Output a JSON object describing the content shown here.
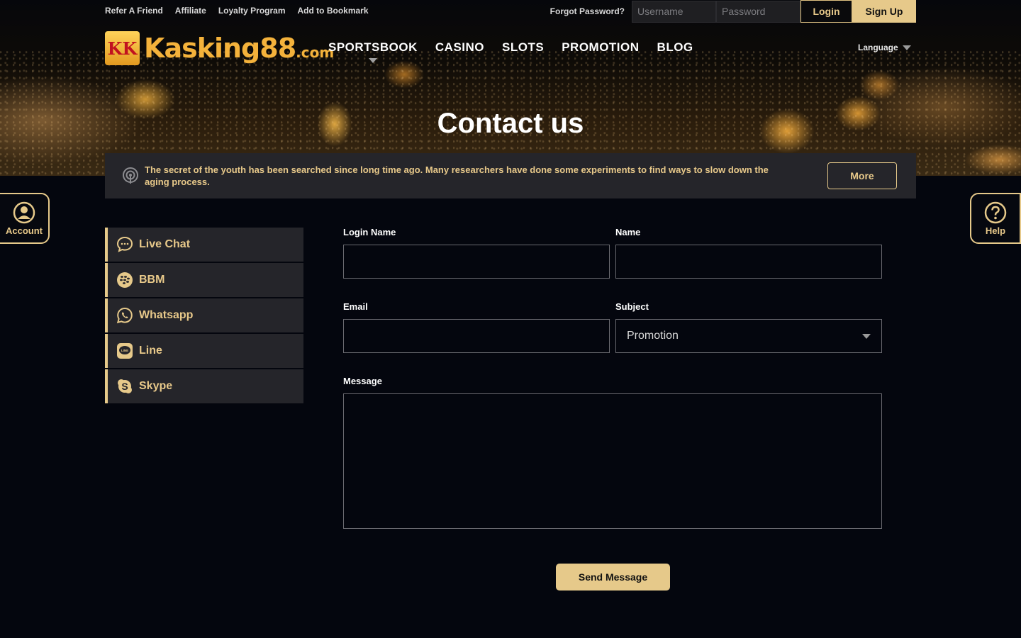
{
  "top_links": [
    "Refer A Friend",
    "Affiliate",
    "Loyalty Program",
    "Add to Bookmark"
  ],
  "auth": {
    "forgot_label": "Forgot Password?",
    "username_placeholder": "Username",
    "password_placeholder": "Password",
    "login_label": "Login",
    "signup_label": "Sign Up"
  },
  "logo": {
    "text": "Kasking88",
    "suffix": ".com",
    "mark": "KK"
  },
  "nav": [
    "SPORTSBOOK",
    "CASINO",
    "SLOTS",
    "PROMOTION",
    "BLOG"
  ],
  "language_label": "Language",
  "page_title": "Contact us",
  "announcement": {
    "text": "The secret of the youth has been searched since long time ago. Many researchers have done some experiments to find ways to slow down the aging process.",
    "more_label": "More"
  },
  "float": {
    "account_label": "Account",
    "help_label": "Help"
  },
  "contact_channels": [
    {
      "label": "Live Chat",
      "icon": "chat-icon"
    },
    {
      "label": "BBM",
      "icon": "blackberry-icon"
    },
    {
      "label": "Whatsapp",
      "icon": "whatsapp-icon"
    },
    {
      "label": "Line",
      "icon": "line-icon"
    },
    {
      "label": "Skype",
      "icon": "skype-icon"
    }
  ],
  "form": {
    "login_name_label": "Login Name",
    "login_name_value": "",
    "name_label": "Name",
    "name_value": "",
    "email_label": "Email",
    "email_value": "",
    "subject_label": "Subject",
    "subject_value": "Promotion",
    "message_label": "Message",
    "message_value": "",
    "send_label": "Send Message"
  },
  "colors": {
    "gold": "#e6c98a",
    "background": "#04060e",
    "panel": "#25252a"
  }
}
